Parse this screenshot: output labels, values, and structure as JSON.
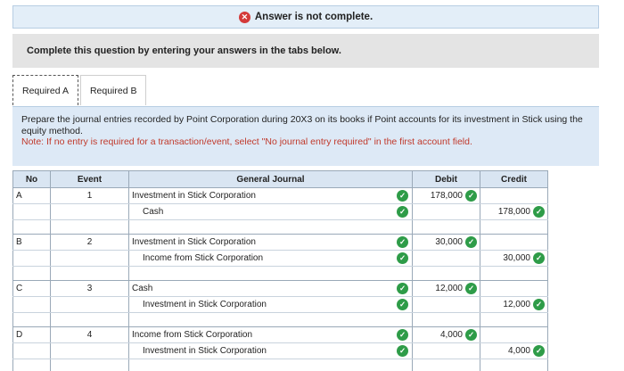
{
  "banner": {
    "text": "Answer is not complete.",
    "icon": "error-x-icon"
  },
  "instruction": "Complete this question by entering your answers in the tabs below.",
  "tabs": [
    {
      "label": "Required A",
      "active": true
    },
    {
      "label": "Required B",
      "active": false
    }
  ],
  "prompt": {
    "text": "Prepare the journal entries recorded by Point Corporation during 20X3 on its books if Point accounts for its investment in Stick using the equity method.",
    "note": "Note: If no entry is required for a transaction/event, select \"No journal entry required\" in the first account field."
  },
  "table": {
    "headers": {
      "no": "No",
      "event": "Event",
      "journal": "General Journal",
      "debit": "Debit",
      "credit": "Credit"
    },
    "entries": [
      {
        "no": "A",
        "event": "1",
        "lines": [
          {
            "account": "Investment in Stick Corporation",
            "debit": "178,000",
            "credit": ""
          },
          {
            "account": "Cash",
            "debit": "",
            "credit": "178,000"
          }
        ]
      },
      {
        "no": "B",
        "event": "2",
        "lines": [
          {
            "account": "Investment in Stick Corporation",
            "debit": "30,000",
            "credit": ""
          },
          {
            "account": "Income from Stick Corporation",
            "debit": "",
            "credit": "30,000"
          }
        ]
      },
      {
        "no": "C",
        "event": "3",
        "lines": [
          {
            "account": "Cash",
            "debit": "12,000",
            "credit": ""
          },
          {
            "account": "Investment in Stick Corporation",
            "debit": "",
            "credit": "12,000"
          }
        ]
      },
      {
        "no": "D",
        "event": "4",
        "lines": [
          {
            "account": "Income from Stick Corporation",
            "debit": "4,000",
            "credit": ""
          },
          {
            "account": "Investment in Stick Corporation",
            "debit": "",
            "credit": "4,000"
          }
        ]
      }
    ]
  },
  "colors": {
    "check": "#2e9c48",
    "error": "#d43a3a",
    "note": "#c0392b",
    "header_bg": "#d9e5f2"
  }
}
